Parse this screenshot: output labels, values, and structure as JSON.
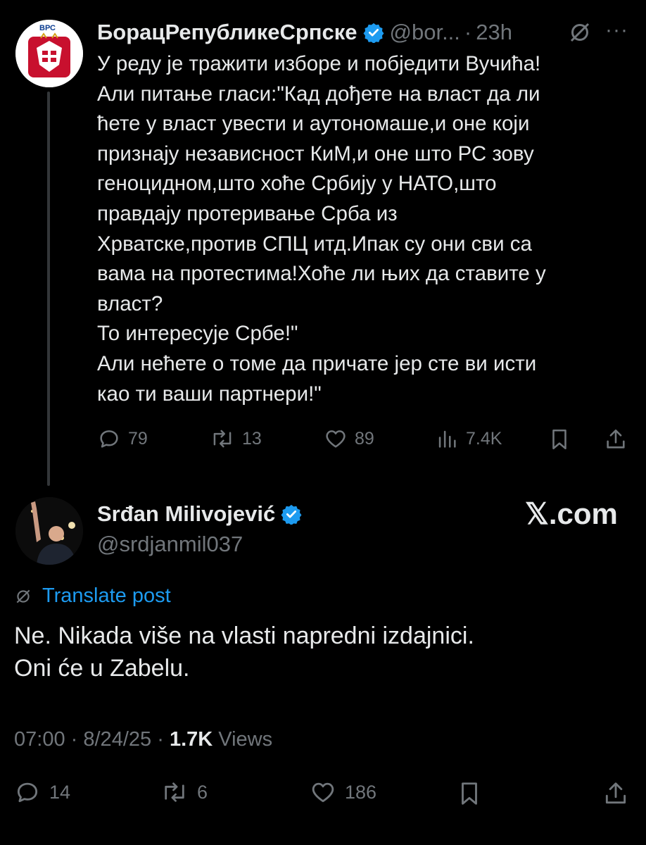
{
  "tweet1": {
    "author_name": "БорацРепубликеСрпске",
    "handle_truncated": "@bor...",
    "separator": "·",
    "time": "23h",
    "more_label": "···",
    "avatar_label": "ВРС",
    "lines": [
      "У реду је тражити изборе и побједити Вучића!",
      "Али питање гласи:\"Кад дођете на власт да ли",
      "ћете у власт увести и аутономаше,и оне који",
      "признају независност КиМ,и оне што РС зову",
      "геноцидном,што хоће Србију у НАТО,што",
      "правдају протеривање Срба из",
      "Хрватске,против СПЦ итд.Ипак су они сви са",
      "вама на протестима!Хоће ли њих да ставите у",
      "власт?",
      "То интересује Србе!\"",
      "Али нећете о томе да причате јер сте ви исти",
      "као ти ваши партнери!\""
    ],
    "actions": {
      "replies": "79",
      "reposts": "13",
      "likes": "89",
      "views": "7.4K"
    }
  },
  "tweet2": {
    "author_name": "Srđan Milivojević",
    "handle": "@srdjanmil037",
    "translate_label": "Translate post",
    "lines": [
      "Ne. Nikada više na vlasti napredni izdajnici.",
      "Oni će u Zabelu."
    ],
    "time": "07:00",
    "date": "8/24/25",
    "sep": "·",
    "views_count": "1.7K",
    "views_label": "Views",
    "actions": {
      "replies": "14",
      "reposts": "6",
      "likes": "186"
    }
  },
  "watermark": {
    "x_glyph": "𝕏",
    "suffix": ".com"
  },
  "colors": {
    "background": "#000000",
    "text": "#e7e9ea",
    "muted": "#71767b",
    "accent": "#1d9bf0"
  }
}
